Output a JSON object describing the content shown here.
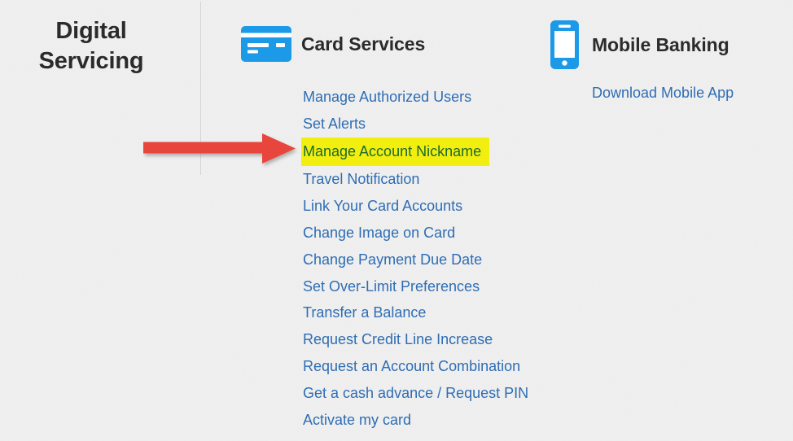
{
  "page": {
    "title": "Digital Servicing",
    "title_lines": [
      "Digital",
      "Servicing"
    ],
    "background_color": "#f0f0f0",
    "divider_color": "#d4d4d4"
  },
  "colors": {
    "heading_text": "#2b2b2b",
    "link_blue": "#2e6db4",
    "icon_blue": "#1c9ae8",
    "highlight_yellow": "#f2ee0f",
    "highlight_text_green": "#1b6b2e",
    "arrow_red": "#e8453c"
  },
  "columns": [
    {
      "id": "card-services",
      "heading": "Card Services",
      "icon": "credit-card-icon",
      "links": [
        {
          "label": "Manage Authorized Users",
          "highlighted": false
        },
        {
          "label": "Set Alerts",
          "highlighted": false
        },
        {
          "label": "Manage Account Nickname",
          "highlighted": true
        },
        {
          "label": "Travel Notification",
          "highlighted": false
        },
        {
          "label": "Link Your Card Accounts",
          "highlighted": false
        },
        {
          "label": "Change Image on Card",
          "highlighted": false
        },
        {
          "label": "Change Payment Due Date",
          "highlighted": false
        },
        {
          "label": "Set Over-Limit Preferences",
          "highlighted": false
        },
        {
          "label": "Transfer a Balance",
          "highlighted": false
        },
        {
          "label": "Request Credit Line Increase",
          "highlighted": false
        },
        {
          "label": "Request an Account Combination",
          "highlighted": false
        },
        {
          "label": "Get a cash advance / Request PIN",
          "highlighted": false
        },
        {
          "label": "Activate my card",
          "highlighted": false
        }
      ]
    },
    {
      "id": "mobile-banking",
      "heading": "Mobile Banking",
      "icon": "mobile-phone-icon",
      "links": [
        {
          "label": "Download Mobile App",
          "highlighted": false
        }
      ]
    }
  ],
  "annotation": {
    "type": "arrow",
    "direction": "right",
    "color": "#e8453c",
    "points_to": "Manage Account Nickname"
  }
}
